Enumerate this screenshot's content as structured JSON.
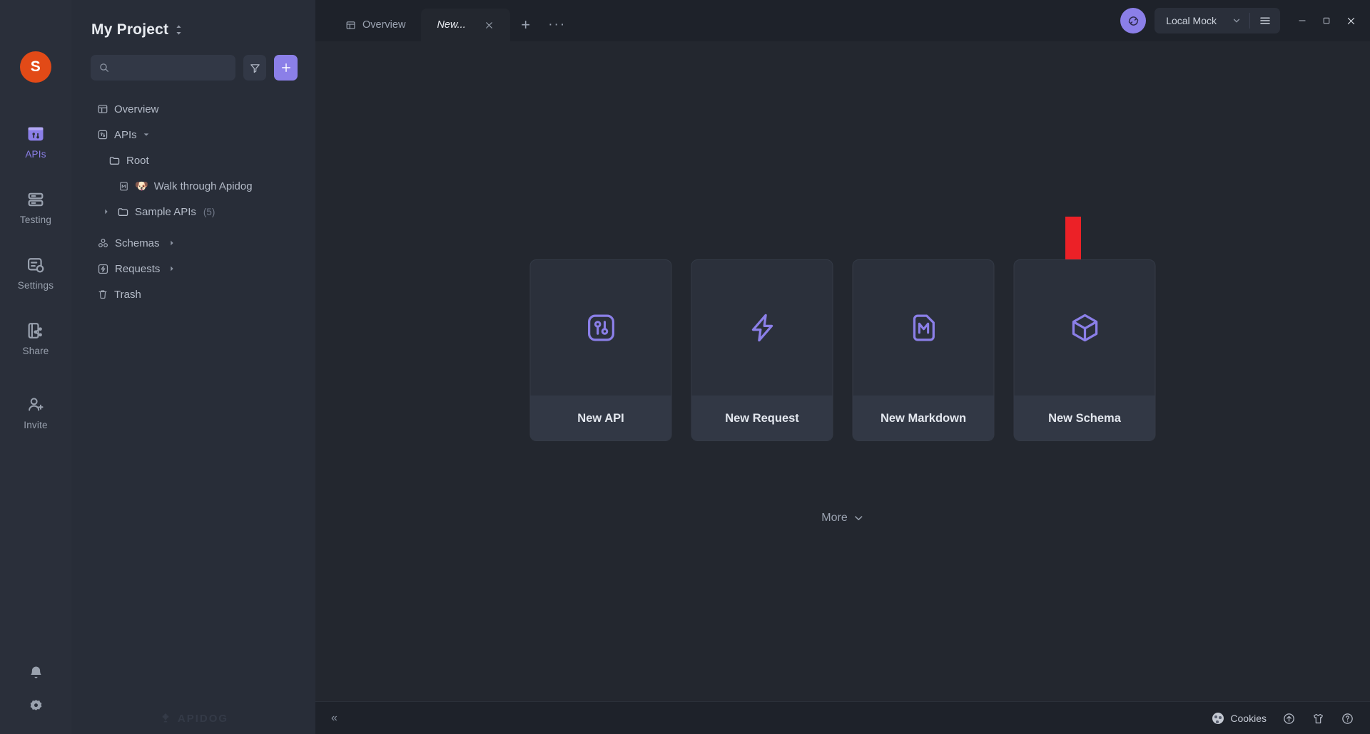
{
  "rail": {
    "avatar_initial": "S",
    "items": [
      {
        "label": "APIs",
        "icon": "apis-icon",
        "active": true
      },
      {
        "label": "Testing",
        "icon": "testing-icon",
        "active": false
      },
      {
        "label": "Settings",
        "icon": "settings-icon",
        "active": false
      },
      {
        "label": "Share",
        "icon": "share-icon",
        "active": false
      },
      {
        "label": "Invite",
        "icon": "invite-icon",
        "active": false
      }
    ],
    "bottom_icons": [
      "bell-icon",
      "gear-icon"
    ]
  },
  "panel": {
    "project_title": "My Project",
    "search": {
      "value": "",
      "placeholder": ""
    },
    "filter_button": "filter-icon",
    "add_button": "plus-icon",
    "tree": [
      {
        "label": "Overview",
        "icon": "overview-icon",
        "level": 0,
        "caret": false,
        "count": ""
      },
      {
        "label": "APIs",
        "icon": "apis-small-icon",
        "level": 0,
        "caret": true,
        "count": ""
      },
      {
        "label": "Root",
        "icon": "folder-icon",
        "level": 1,
        "caret": false,
        "count": ""
      },
      {
        "label": "Walk through Apidog",
        "icon": "markdown-icon",
        "level": 2,
        "caret": false,
        "count": "",
        "emoji": "🐶"
      },
      {
        "label": "Sample APIs",
        "icon": "folder-icon",
        "level": 1,
        "caret": true,
        "count": "(5)"
      },
      {
        "label": "Schemas",
        "icon": "schemas-icon",
        "level": 0,
        "caret": true,
        "count": ""
      },
      {
        "label": "Requests",
        "icon": "requests-icon",
        "level": 0,
        "caret": true,
        "count": ""
      },
      {
        "label": "Trash",
        "icon": "trash-icon",
        "level": 0,
        "caret": false,
        "count": ""
      }
    ],
    "watermark": "APIDOG"
  },
  "tabs": {
    "items": [
      {
        "label": "Overview",
        "icon": "overview-icon",
        "active": false,
        "closable": false
      },
      {
        "label": "New...",
        "icon": "",
        "active": true,
        "closable": true
      }
    ],
    "new_tab_button": "+",
    "overflow_button": "···"
  },
  "topbar": {
    "refresh_button": "refresh-icon",
    "environment": "Local Mock",
    "env_caret": "chevron-down-icon",
    "menu_button": "hamburger-icon",
    "window_minimize": "−",
    "window_maximize": "□",
    "window_close": "✕"
  },
  "main": {
    "cards": [
      {
        "label": "New API",
        "icon": "new-api-icon"
      },
      {
        "label": "New Request",
        "icon": "lightning-icon"
      },
      {
        "label": "New Markdown",
        "icon": "markdown-m-icon"
      },
      {
        "label": "New Schema",
        "icon": "cube-icon"
      }
    ],
    "more_label": "More",
    "more_caret": "chevron-down-icon",
    "annotation": {
      "type": "red-arrow",
      "points_to": "New Request",
      "color": "#ec2127"
    }
  },
  "statusbar": {
    "collapse_button": "«",
    "cookies_label": "Cookies",
    "icons": [
      "upload-circle-icon",
      "shirt-icon",
      "help-circle-icon"
    ]
  },
  "colors": {
    "accent": "#8b7fe8",
    "avatar": "#e24a17",
    "arrow_red": "#ec2127",
    "rail_bg": "#2a2f3a",
    "panel_bg": "#282d38",
    "main_bg": "#23272f",
    "bar_bg": "#1e222a",
    "card_bg": "#2b303b"
  }
}
